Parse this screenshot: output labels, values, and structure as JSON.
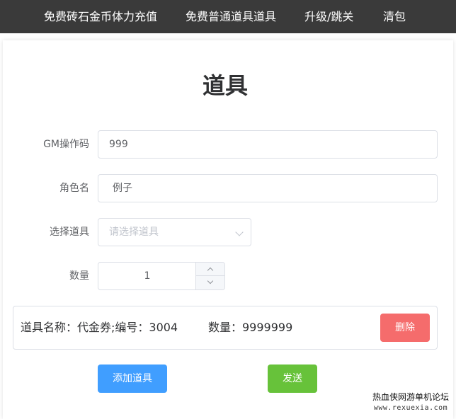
{
  "nav": {
    "items": [
      "免费砖石金币体力充值",
      "免费普通道具道具",
      "升级/跳关",
      "清包"
    ]
  },
  "page": {
    "title": "道具"
  },
  "form": {
    "gm_code": {
      "label": "GM操作码",
      "value": "999"
    },
    "role_name": {
      "label": "角色名",
      "value": "例子"
    },
    "item_select": {
      "label": "选择道具",
      "placeholder": "请选择道具"
    },
    "quantity": {
      "label": "数量",
      "value": "1"
    }
  },
  "item_list": [
    {
      "name_text": "道具名称：代金券;编号：3004",
      "qty_text": "数量：9999999",
      "delete_label": "删除"
    }
  ],
  "actions": {
    "add_label": "添加道具",
    "send_label": "发送"
  },
  "watermark": {
    "line1": "热血侠网游单机论坛",
    "line2": "www.rexuexia.com"
  },
  "colors": {
    "nav_bg": "#3a3a3a",
    "primary": "#409eff",
    "success": "#67c23a",
    "danger": "#f56c6c"
  }
}
